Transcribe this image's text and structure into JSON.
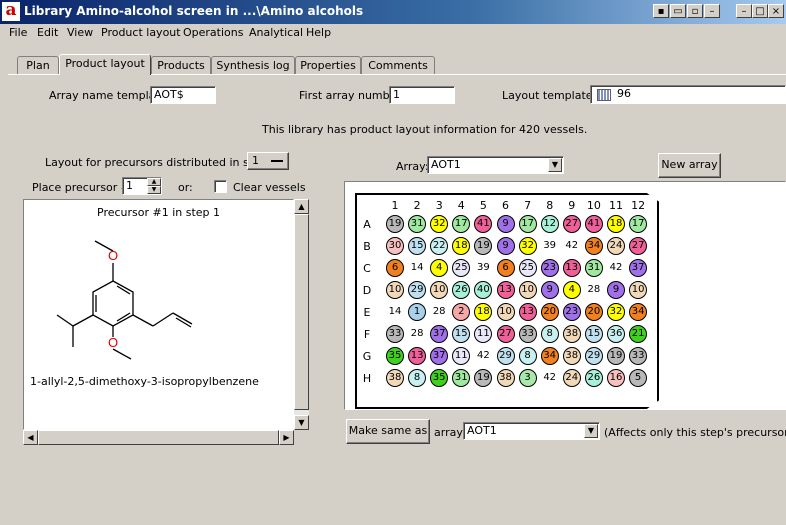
{
  "window": {
    "title": "Library Amino-alcohol screen in ...\\Amino alcohols",
    "buttons": [
      "▪",
      "▭",
      "▫",
      "–",
      "□",
      "×"
    ]
  },
  "menu": [
    "File",
    "Edit",
    "View",
    "Product layout",
    "Operations",
    "Analytical",
    "Help"
  ],
  "tabs": [
    "Plan",
    "Product layout",
    "Products",
    "Synthesis log",
    "Properties",
    "Comments"
  ],
  "active_tab": "Product layout",
  "form": {
    "array_name_label": "Array name template:",
    "array_name_value": "AOT$",
    "first_array_label": "First array number:",
    "first_array_value": "1",
    "layout_template_label": "Layout template:",
    "layout_template_value": "96",
    "info_text": "This library has product layout information for 420 vessels.",
    "precursors_label": "Layout for precursors distributed in step #:",
    "step_value": "1",
    "place_label": "Place precursor #:",
    "place_value": "1",
    "or_label": "or:",
    "clear_label": "Clear vessels",
    "array_label": "Array:",
    "array_value": "AOT1",
    "new_array_label": "New array",
    "make_same_label": "Make same as",
    "array2_label": "array:",
    "array2_value": "AOT1",
    "affects_note": "(Affects only this step's precursors)"
  },
  "precursor_panel": {
    "heading": "Precursor #1 in step 1",
    "compound_name": "1-allyl-2,5-dimethoxy-3-isopropylbenzene",
    "atom_labels": [
      "O",
      "O"
    ]
  },
  "plate": {
    "columns": [
      "1",
      "2",
      "3",
      "4",
      "5",
      "6",
      "7",
      "8",
      "9",
      "10",
      "11",
      "12"
    ],
    "rows": [
      "A",
      "B",
      "C",
      "D",
      "E",
      "F",
      "G",
      "H"
    ],
    "wells": [
      [
        "19",
        "31",
        "32",
        "17",
        "41",
        "9",
        "17",
        "12",
        "27",
        "41",
        "18",
        "17"
      ],
      [
        "30",
        "15",
        "22",
        "18",
        "19",
        "9",
        "32",
        "39",
        "42",
        "34",
        "24",
        "27"
      ],
      [
        "6",
        "14",
        "4",
        "25",
        "39",
        "6",
        "25",
        "23",
        "13",
        "31",
        "42",
        "37"
      ],
      [
        "10",
        "29",
        "10",
        "26",
        "40",
        "13",
        "10",
        "9",
        "4",
        "28",
        "9",
        "10"
      ],
      [
        "14",
        "1",
        "28",
        "2",
        "18",
        "10",
        "13",
        "20",
        "23",
        "20",
        "32",
        "34"
      ],
      [
        "33",
        "28",
        "37",
        "15",
        "11",
        "27",
        "33",
        "8",
        "38",
        "15",
        "36",
        "21"
      ],
      [
        "35",
        "13",
        "37",
        "11",
        "42",
        "29",
        "8",
        "34",
        "38",
        "29",
        "19",
        "33"
      ],
      [
        "38",
        "8",
        "35",
        "31",
        "19",
        "38",
        "3",
        "42",
        "24",
        "26",
        "16",
        "5"
      ]
    ],
    "colors": {
      "1": "#a8d0e8",
      "2": "#f4a8a8",
      "3": "#a8e8a8",
      "4": "#ffff00",
      "5": "#b8b8b8",
      "6": "#f08020",
      "8": "#c8f0f0",
      "9": "#a070e8",
      "10": "#f0d8b8",
      "11": "#e8e8f8",
      "12": "#a8f0d8",
      "13": "#f06098",
      "14": "#ffffff",
      "15": "#c0e0f0",
      "16": "#f8c0c0",
      "17": "#a0e8a0",
      "18": "#ffff00",
      "19": "#b8b8b8",
      "20": "#f08020",
      "21": "#40d020",
      "22": "#c8f0f0",
      "23": "#a070e8",
      "24": "#f0d8b8",
      "25": "#e8e8f8",
      "26": "#a8f0d8",
      "27": "#f06098",
      "28": "#ffffff",
      "29": "#c0e0f0",
      "30": "#f8c0c0",
      "31": "#a0e8a0",
      "32": "#ffff00",
      "33": "#b8b8b8",
      "34": "#f08020",
      "35": "#40d020",
      "36": "#c8f0f0",
      "37": "#a070e8",
      "38": "#f0d8b8",
      "39": "#ffffff",
      "40": "#a8f0d8",
      "41": "#f06098",
      "42": "#ffffff"
    }
  }
}
